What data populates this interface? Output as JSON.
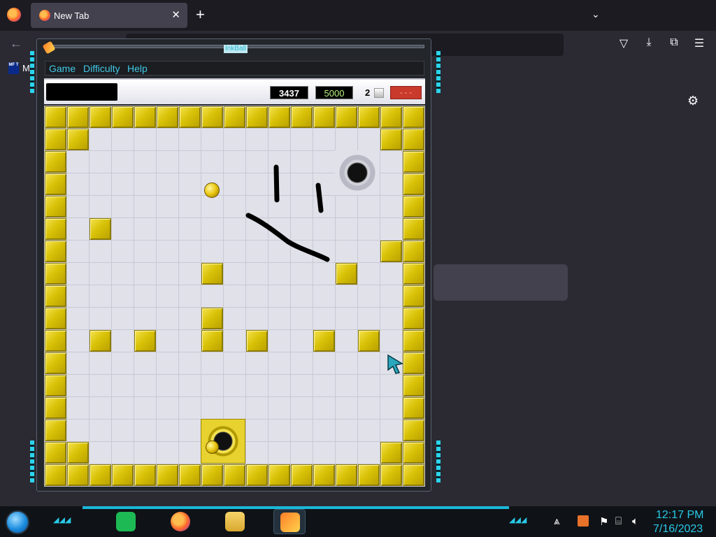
{
  "browser": {
    "tab_title": "New Tab",
    "tab_close": "✕",
    "new_tab": "+",
    "tab_list": "⌄",
    "back": "←",
    "toolbar_icons": [
      "pocket-icon",
      "download-icon",
      "extensions-icon",
      "menu-icon"
    ],
    "bookmark_icon_text": "MF T",
    "bookmark_label": "M",
    "settings": "⚙"
  },
  "inkball": {
    "window_title": "InkBall",
    "menu": [
      "Game",
      "Difficulty",
      "Help"
    ],
    "time": "3437",
    "score": "5000",
    "balls_remaining": "2",
    "status": "- - -",
    "grid_size": 17,
    "blocks": [
      [
        0,
        0
      ],
      [
        1,
        0
      ],
      [
        2,
        0
      ],
      [
        3,
        0
      ],
      [
        4,
        0
      ],
      [
        5,
        0
      ],
      [
        6,
        0
      ],
      [
        7,
        0
      ],
      [
        8,
        0
      ],
      [
        9,
        0
      ],
      [
        10,
        0
      ],
      [
        11,
        0
      ],
      [
        12,
        0
      ],
      [
        13,
        0
      ],
      [
        14,
        0
      ],
      [
        15,
        0
      ],
      [
        16,
        0
      ],
      [
        0,
        16
      ],
      [
        1,
        16
      ],
      [
        2,
        16
      ],
      [
        3,
        16
      ],
      [
        4,
        16
      ],
      [
        5,
        16
      ],
      [
        6,
        16
      ],
      [
        7,
        16
      ],
      [
        8,
        16
      ],
      [
        9,
        16
      ],
      [
        10,
        16
      ],
      [
        11,
        16
      ],
      [
        12,
        16
      ],
      [
        13,
        16
      ],
      [
        14,
        16
      ],
      [
        15,
        16
      ],
      [
        16,
        16
      ],
      [
        0,
        1
      ],
      [
        0,
        2
      ],
      [
        0,
        3
      ],
      [
        0,
        4
      ],
      [
        0,
        5
      ],
      [
        0,
        6
      ],
      [
        0,
        7
      ],
      [
        0,
        8
      ],
      [
        0,
        9
      ],
      [
        0,
        10
      ],
      [
        0,
        11
      ],
      [
        0,
        12
      ],
      [
        0,
        13
      ],
      [
        0,
        14
      ],
      [
        0,
        15
      ],
      [
        16,
        1
      ],
      [
        16,
        2
      ],
      [
        16,
        3
      ],
      [
        16,
        4
      ],
      [
        16,
        5
      ],
      [
        16,
        6
      ],
      [
        16,
        7
      ],
      [
        16,
        8
      ],
      [
        16,
        9
      ],
      [
        16,
        10
      ],
      [
        16,
        11
      ],
      [
        16,
        12
      ],
      [
        16,
        13
      ],
      [
        16,
        14
      ],
      [
        16,
        15
      ],
      [
        1,
        1
      ],
      [
        15,
        1
      ],
      [
        1,
        15
      ],
      [
        15,
        15
      ],
      [
        2,
        5
      ],
      [
        15,
        6
      ],
      [
        7,
        7
      ],
      [
        13,
        7
      ],
      [
        7,
        9
      ],
      [
        2,
        10
      ],
      [
        4,
        10
      ],
      [
        7,
        10
      ],
      [
        9,
        10
      ],
      [
        12,
        10
      ],
      [
        14,
        10
      ]
    ],
    "holes": [
      {
        "color": "gray",
        "cell": [
          13,
          2
        ]
      },
      {
        "color": "yellow",
        "cell": [
          7,
          14
        ]
      }
    ],
    "balls": [
      {
        "color": "yellow",
        "cell": [
          7,
          3
        ]
      },
      {
        "color": "yellow",
        "cell": [
          7,
          15
        ]
      }
    ]
  },
  "taskbar": {
    "apps": [
      "spotify-icon",
      "firefox-icon",
      "file-explorer-icon",
      "inkball-icon"
    ],
    "tray_icons": [
      "app-tray-icon",
      "flag-icon",
      "network-icon",
      "volume-icon"
    ],
    "clock_time": "12:17 PM",
    "clock_date": "7/16/2023"
  }
}
